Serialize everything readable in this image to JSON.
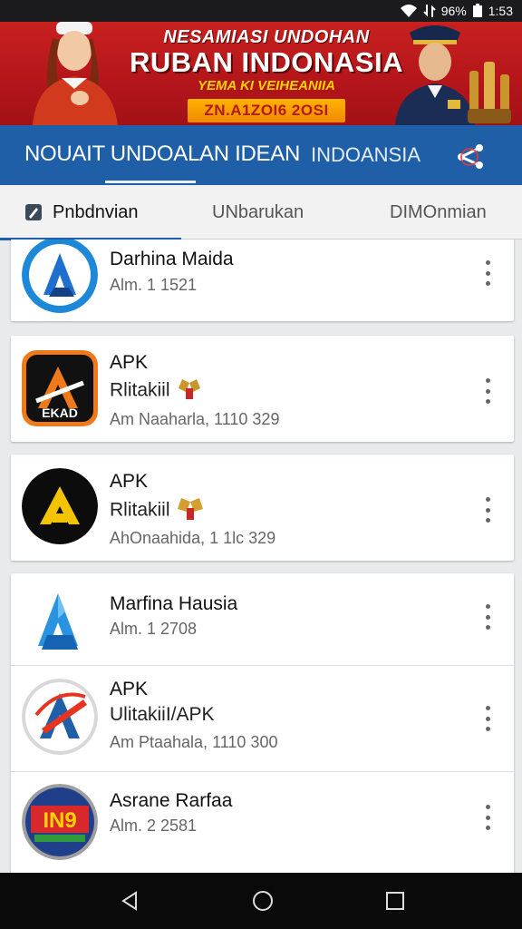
{
  "status_bar": {
    "battery": "96%",
    "time": "1:53"
  },
  "banner": {
    "line1": "NESAMIASI UNDOHAN",
    "line2": "RUBAN INDONASIA",
    "line3": "YEMA KI VEIHEANIIA",
    "pill": "ZN.A1ZOI6 2OSI"
  },
  "app_bar": {
    "title": "NOUAIT UNDOALAN IDEAN",
    "subtitle": "INDOANSIA"
  },
  "tabs": [
    {
      "label": "Pnbdnvian"
    },
    {
      "label": "UNbarukan"
    },
    {
      "label": "DIMOnmian"
    }
  ],
  "apps": [
    {
      "name": "Darhina Maida",
      "meta": "Alm. 1 1521"
    },
    {
      "name": "APK",
      "sub": "Rlitakiil",
      "meta": "Am Naaharla, 1110 329"
    },
    {
      "name": "APK",
      "sub": "Rlitakiil",
      "meta": "AhOnaahida, 1 1lc 329"
    },
    {
      "name": "Marfina Hausia",
      "meta": "Alm. 1 2708"
    },
    {
      "name": "APK",
      "sub": "UlitakiiI/APK",
      "meta": "Am Ptaahala, 1110 300"
    },
    {
      "name": "Asrane Rarfaa",
      "meta": "Alm. 2 2581"
    }
  ],
  "icons": {
    "wifi": "wifi-icon",
    "data": "data-icon",
    "battery": "battery-icon",
    "share": "share-icon",
    "tab1": "edit-icon",
    "kebab": "more-vert-icon",
    "back": "back-icon",
    "home": "home-icon",
    "recents": "recents-icon"
  },
  "colors": {
    "banner_red": "#b3151a",
    "app_bar_blue": "#1f5fa8",
    "banner_yellow": "#ffd200",
    "nav_bar": "#0a0a0a"
  }
}
